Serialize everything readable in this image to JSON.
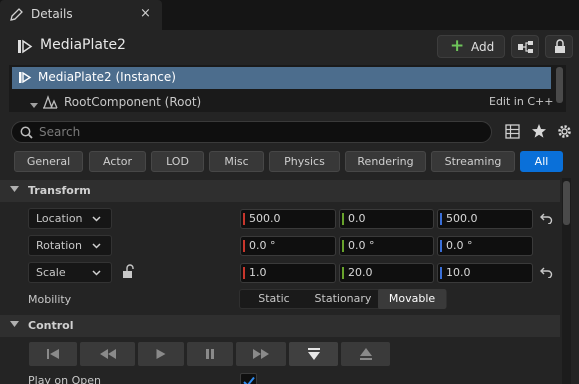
{
  "tab": {
    "title": "Details",
    "close": "×",
    "icon": "pencil-icon"
  },
  "header": {
    "object_name": "MediaPlate2",
    "add_label": "Add",
    "add_icon": "plus-icon"
  },
  "tree": {
    "selected": "MediaPlate2 (Instance)",
    "root": "RootComponent (Root)",
    "edit_link": "Edit in C++"
  },
  "search": {
    "placeholder": "Search"
  },
  "filters": [
    "General",
    "Actor",
    "LOD",
    "Misc",
    "Physics",
    "Rendering",
    "Streaming",
    "All"
  ],
  "active_filter": "All",
  "transform": {
    "title": "Transform",
    "location": {
      "label": "Location",
      "x": "500.0",
      "y": "0.0",
      "z": "500.0"
    },
    "rotation": {
      "label": "Rotation",
      "x": "0.0 °",
      "y": "0.0 °",
      "z": "0.0 °"
    },
    "scale": {
      "label": "Scale",
      "x": "1.0",
      "y": "20.0",
      "z": "10.0"
    },
    "mobility": {
      "label": "Mobility",
      "options": [
        "Static",
        "Stationary",
        "Movable"
      ],
      "selected": "Movable"
    }
  },
  "control": {
    "title": "Control",
    "buttons": [
      "rewind-to-start-icon",
      "fast-rewind-icon",
      "play-icon",
      "pause-icon",
      "fast-forward-icon",
      "open-media-icon",
      "eject-icon"
    ],
    "play_on_open_label": "Play on Open",
    "play_on_open": true
  },
  "colors": {
    "x_axis": "#c8362c",
    "y_axis": "#68a32c",
    "z_axis": "#3a6fd8",
    "accent": "#0a70d9",
    "selection": "#4c6d8d"
  }
}
